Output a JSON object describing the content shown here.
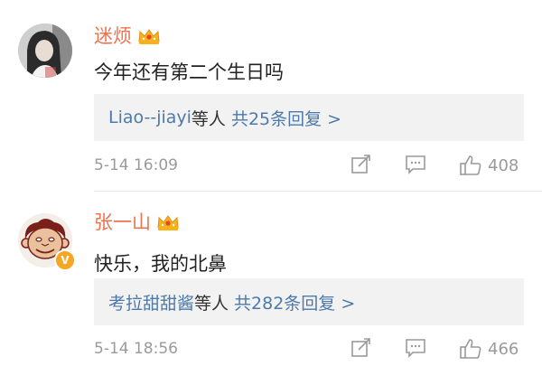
{
  "comments": [
    {
      "username": "迷烦",
      "text": "今年还有第二个生日吗",
      "reply_users": "Liao--jiayi",
      "reply_mid": "等人",
      "reply_count": "共25条回复 >",
      "time": "5-14 16:09",
      "likes": "408",
      "avatar_icon": "user-avatar-photo"
    },
    {
      "username": "张一山",
      "text": "快乐，我的北鼻",
      "reply_users": "考拉甜甜酱",
      "reply_mid": "等人",
      "reply_count": "共282条回复 >",
      "time": "5-14 18:56",
      "likes": "466",
      "avatar_icon": "monkey-avatar",
      "verified_badge": "V"
    }
  ],
  "colors": {
    "username": "#eb7350",
    "link": "#4e7aa9",
    "meta": "#9a9a9a",
    "reply_bg": "#f2f2f2"
  }
}
